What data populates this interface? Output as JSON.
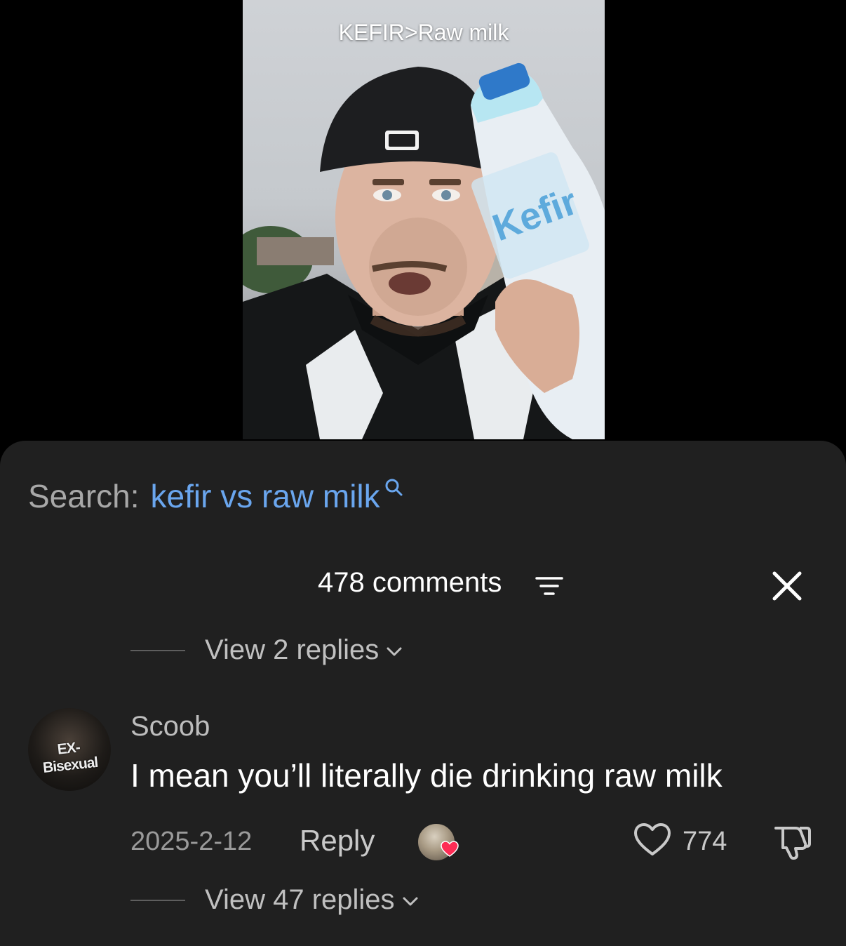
{
  "video": {
    "caption": "KEFIR>Raw milk",
    "bottle_label": "Kefir"
  },
  "search": {
    "prefix": "Search:",
    "query": "kefir vs raw milk",
    "icon": "search-icon"
  },
  "comments": {
    "count_label": "478 comments",
    "filter_icon": "filter-icon",
    "close_icon": "close-icon"
  },
  "thread_top": {
    "view_replies_label": "View 2 replies"
  },
  "comment": {
    "avatar_text": "EX-Bisexual",
    "username": "Scoob",
    "text": "I mean you’ll literally die drinking raw milk",
    "date": "2025-2-12",
    "reply_label": "Reply",
    "like_count": "774",
    "view_replies_label": "View 47 replies"
  },
  "colors": {
    "sheet_bg": "#202020",
    "search_query": "#6aa6ee",
    "heart_badge": "#fe2c55"
  }
}
